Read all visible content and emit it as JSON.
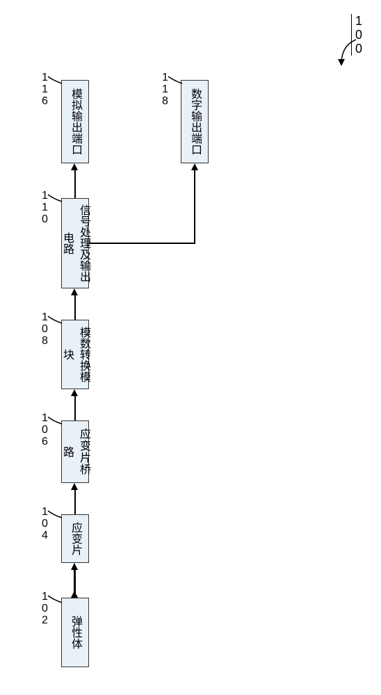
{
  "diagram": {
    "title": "100",
    "blocks": {
      "b102": {
        "label": "弹性体",
        "ref": "102"
      },
      "b104": {
        "label": "应变片",
        "ref": "104"
      },
      "b106": {
        "label": "应变片桥路",
        "ref": "106"
      },
      "b108": {
        "label": "模数转换模块",
        "ref": "108"
      },
      "b110": {
        "label": "信号处理及输出电路",
        "ref": "110"
      },
      "b116": {
        "label": "模拟输出端口",
        "ref": "116"
      },
      "b118": {
        "label": "数字输出端口",
        "ref": "118"
      }
    }
  }
}
